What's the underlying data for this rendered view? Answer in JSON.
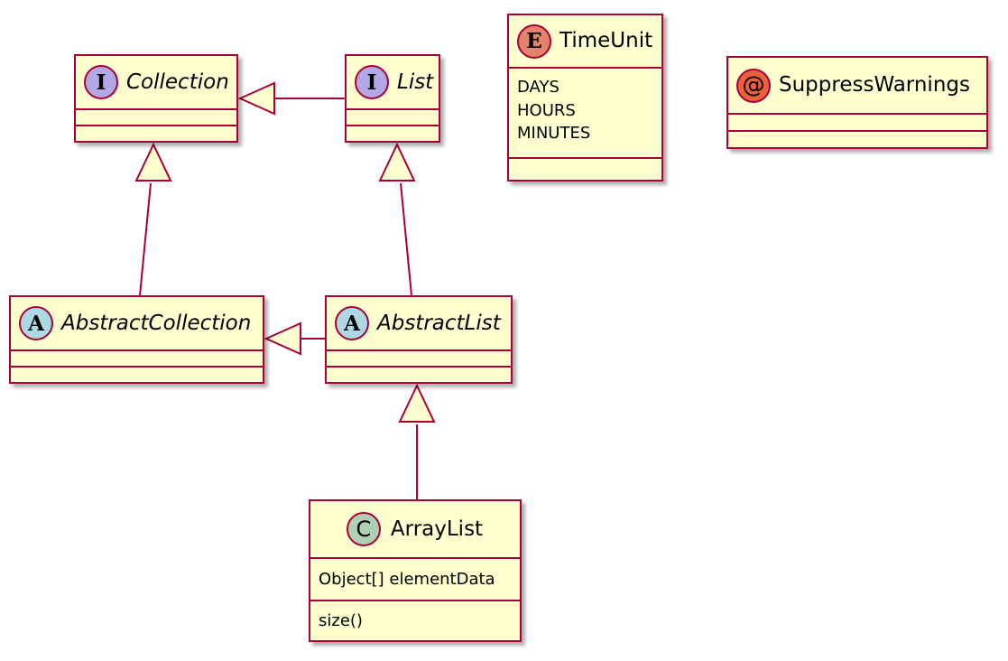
{
  "diagram": {
    "kind": "uml-class-diagram",
    "background": "#FFFFFF",
    "line_color": "#A80036",
    "node_fill": "#FEFECE"
  },
  "nodes": {
    "collection": {
      "name": "Collection",
      "stereotype": "interface",
      "badge_glyph": "I",
      "badge_color": "#B4A7E5",
      "italic": true,
      "fields": [],
      "methods": []
    },
    "list": {
      "name": "List",
      "stereotype": "interface",
      "badge_glyph": "I",
      "badge_color": "#B4A7E5",
      "italic": true,
      "fields": [],
      "methods": []
    },
    "timeunit": {
      "name": "TimeUnit",
      "stereotype": "enum",
      "badge_glyph": "E",
      "badge_color": "#E3836B",
      "italic": false,
      "values": [
        "DAYS",
        "HOURS",
        "MINUTES"
      ]
    },
    "suppresswarnings": {
      "name": "SuppressWarnings",
      "stereotype": "annotation",
      "badge_glyph": "@",
      "badge_color": "#E8603C",
      "italic": false,
      "fields": [],
      "methods": []
    },
    "abstractcollection": {
      "name": "AbstractCollection",
      "stereotype": "abstract class",
      "badge_glyph": "A",
      "badge_color": "#ADD8E6",
      "italic": true,
      "fields": [],
      "methods": []
    },
    "abstractlist": {
      "name": "AbstractList",
      "stereotype": "abstract class",
      "badge_glyph": "A",
      "badge_color": "#ADD8E6",
      "italic": true,
      "fields": [],
      "methods": []
    },
    "arraylist": {
      "name": "ArrayList",
      "stereotype": "class",
      "badge_glyph": "C",
      "badge_color": "#ADD1B2",
      "italic": false,
      "field": "Object[] elementData",
      "method": "size()"
    }
  },
  "relationships": [
    {
      "id": "list-extends-collection",
      "type": "generalization",
      "from": "List",
      "to": "Collection",
      "arrow": "hollow-triangle"
    },
    {
      "id": "abstractcollection-implements-collection",
      "type": "generalization",
      "from": "AbstractCollection",
      "to": "Collection",
      "arrow": "hollow-triangle"
    },
    {
      "id": "abstractlist-implements-list",
      "type": "generalization",
      "from": "AbstractList",
      "to": "List",
      "arrow": "hollow-triangle"
    },
    {
      "id": "abstractlist-extends-abstractcollection",
      "type": "generalization",
      "from": "AbstractList",
      "to": "AbstractCollection",
      "arrow": "hollow-triangle"
    },
    {
      "id": "arraylist-extends-abstractlist",
      "type": "generalization",
      "from": "ArrayList",
      "to": "AbstractList",
      "arrow": "hollow-triangle"
    }
  ]
}
